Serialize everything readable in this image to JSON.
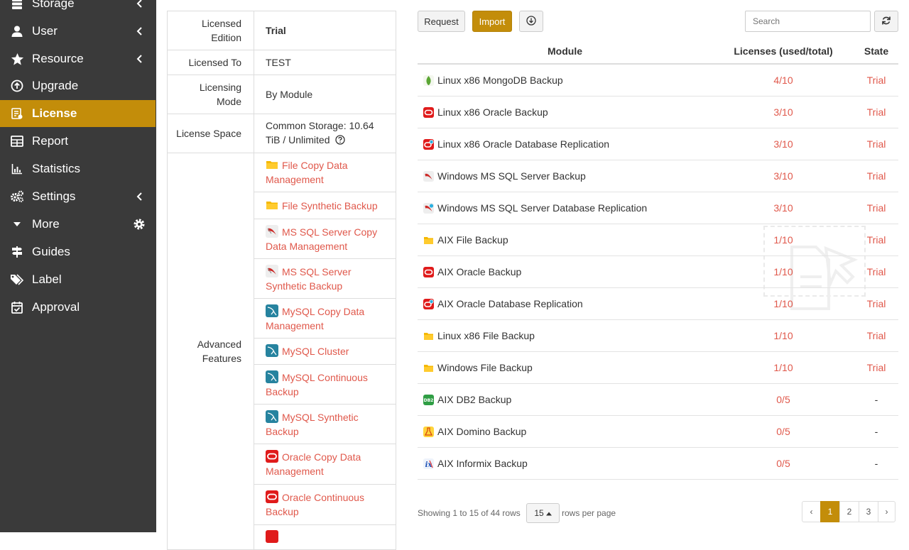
{
  "sidebar": {
    "items": [
      {
        "label": "Storage",
        "icon": "database-icon"
      },
      {
        "label": "User",
        "icon": "user-icon"
      },
      {
        "label": "Resource",
        "icon": "star-icon"
      },
      {
        "label": "Upgrade",
        "icon": "arrow-circle-up-icon"
      },
      {
        "label": "License",
        "icon": "license-icon"
      },
      {
        "label": "Report",
        "icon": "table-icon"
      },
      {
        "label": "Statistics",
        "icon": "bar-chart-icon"
      },
      {
        "label": "Settings",
        "icon": "gears-icon"
      },
      {
        "label": "More",
        "icon": "caret-down-icon"
      },
      {
        "label": "Guides",
        "icon": "signpost-icon"
      },
      {
        "label": "Label",
        "icon": "tags-icon"
      },
      {
        "label": "Approval",
        "icon": "calendar-check-icon"
      }
    ],
    "active_color": "#c38d0a"
  },
  "license_info": {
    "edition_key": "Licensed Edition",
    "edition_value": "Trial",
    "to_key": "Licensed To",
    "to_value": "TEST",
    "mode_key": "Licensing Mode",
    "mode_value": "By Module",
    "space_key": "License Space",
    "space_value": "Common Storage: 10.64 TiB / Unlimited",
    "features_key": "Advanced Features",
    "features": [
      {
        "label": "File Copy Data Management",
        "icon": "folder-icon"
      },
      {
        "label": "File Synthetic Backup",
        "icon": "folder-icon"
      },
      {
        "label": "MS SQL Server Copy Data Management",
        "icon": "mssql-icon"
      },
      {
        "label": "MS SQL Server Synthetic Backup",
        "icon": "mssql-icon"
      },
      {
        "label": "MySQL Copy Data Management",
        "icon": "mysql-icon"
      },
      {
        "label": "MySQL Cluster",
        "icon": "mysql-icon"
      },
      {
        "label": "MySQL Continuous Backup",
        "icon": "mysql-icon"
      },
      {
        "label": "MySQL Synthetic Backup",
        "icon": "mysql-icon"
      },
      {
        "label": "Oracle Copy Data Management",
        "icon": "oracle-icon"
      },
      {
        "label": "Oracle Continuous Backup",
        "icon": "oracle-icon"
      }
    ]
  },
  "toolbar": {
    "request_label": "Request",
    "import_label": "Import",
    "download_icon": "download-circle-icon",
    "search_placeholder": "Search",
    "refresh_icon": "refresh-icon"
  },
  "grid": {
    "columns": [
      "Module",
      "Licenses (used/total)",
      "State"
    ],
    "rows": [
      {
        "module": "Linux x86 MongoDB Backup",
        "icon": "mongodb-icon",
        "licenses": "4/10",
        "state": "Trial"
      },
      {
        "module": "Linux x86 Oracle Backup",
        "icon": "oracle-icon",
        "licenses": "3/10",
        "state": "Trial"
      },
      {
        "module": "Linux x86 Oracle Database Replication",
        "icon": "oracle-replication-icon",
        "licenses": "3/10",
        "state": "Trial"
      },
      {
        "module": "Windows MS SQL Server Backup",
        "icon": "mssql-icon",
        "licenses": "3/10",
        "state": "Trial"
      },
      {
        "module": "Windows MS SQL Server Database Replication",
        "icon": "mssql-replication-icon",
        "licenses": "3/10",
        "state": "Trial"
      },
      {
        "module": "AIX File Backup",
        "icon": "folder-icon",
        "licenses": "1/10",
        "state": "Trial"
      },
      {
        "module": "AIX Oracle Backup",
        "icon": "oracle-icon",
        "licenses": "1/10",
        "state": "Trial"
      },
      {
        "module": "AIX Oracle Database Replication",
        "icon": "oracle-replication-icon",
        "licenses": "1/10",
        "state": "Trial"
      },
      {
        "module": "Linux x86 File Backup",
        "icon": "folder-icon",
        "licenses": "1/10",
        "state": "Trial"
      },
      {
        "module": "Windows File Backup",
        "icon": "folder-icon",
        "licenses": "1/10",
        "state": "Trial"
      },
      {
        "module": "AIX DB2 Backup",
        "icon": "db2-icon",
        "licenses": "0/5",
        "state": "-"
      },
      {
        "module": "AIX Domino Backup",
        "icon": "domino-icon",
        "licenses": "0/5",
        "state": "-"
      },
      {
        "module": "AIX Informix Backup",
        "icon": "informix-icon",
        "licenses": "0/5",
        "state": "-"
      }
    ]
  },
  "footer": {
    "showing": "Showing 1 to 15 of 44 rows",
    "page_size": "15",
    "rows_per_page": "rows per page",
    "prev": "‹",
    "pages": [
      "1",
      "2",
      "3"
    ],
    "next": "›"
  }
}
